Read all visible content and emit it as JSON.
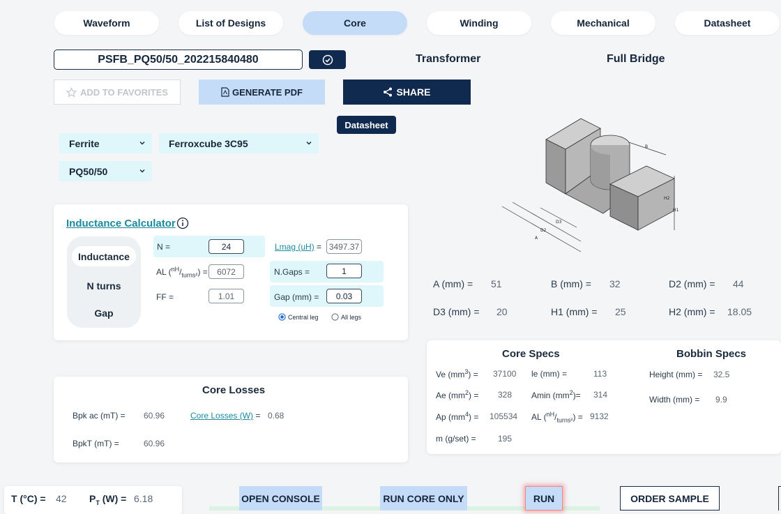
{
  "tabs": [
    {
      "label": "Waveform",
      "active": false
    },
    {
      "label": "List of Designs",
      "active": false
    },
    {
      "label": "Core",
      "active": true
    },
    {
      "label": "Winding",
      "active": false
    },
    {
      "label": "Mechanical",
      "active": false
    },
    {
      "label": "Datasheet",
      "active": false
    }
  ],
  "design": {
    "name": "PSFB_PQ50/50_202215840480",
    "type": "Transformer",
    "topology": "Full Bridge"
  },
  "actions": {
    "favorites": "ADD TO FAVORITES",
    "pdf": "GENERATE PDF",
    "share": "SHARE",
    "datasheet": "Datasheet"
  },
  "selects": {
    "material_type": "Ferrite",
    "material": "Ferroxcube 3C95",
    "shape": "PQ50/50"
  },
  "inductance_calc": {
    "title": "Inductance Calculator",
    "modes": [
      "Inductance",
      "N turns",
      "Gap"
    ],
    "active_mode": "Inductance",
    "n_label": "N =",
    "n_value": "24",
    "al_label_pre": "AL (",
    "al_label_sup": "nH",
    "al_label_sub": "turns²",
    "al_label_post": ") =",
    "al_value": "6072",
    "ff_label": "FF =",
    "ff_value": "1.01",
    "lmag_label": "Lmag (uH)",
    "lmag_eq": "=",
    "lmag_value": "3497.37",
    "ngaps_label": "N.Gaps =",
    "ngaps_value": "1",
    "gap_label": "Gap (mm) =",
    "gap_value": "0.03",
    "radio_central": "Central leg",
    "radio_all": "All legs"
  },
  "dimensions": {
    "a_label": "A (mm) =",
    "a_value": "51",
    "b_label": "B (mm) =",
    "b_value": "32",
    "d2_label": "D2 (mm) =",
    "d2_value": "44",
    "d3_label": "D3 (mm) =",
    "d3_value": "20",
    "h1_label": "H1 (mm) =",
    "h1_value": "25",
    "h2_label": "H2 (mm) =",
    "h2_value": "18.05"
  },
  "drawing_labels": {
    "a": "A",
    "b": "B",
    "d2": "D2",
    "d3": "D3",
    "h1": "H1",
    "h2": "H2"
  },
  "core_specs": {
    "title": "Core Specs",
    "ve_label": "Ve (mm",
    "ve_sup": "3",
    "ve_post": ") =",
    "ve_value": "37100",
    "le_label": "le (mm) =",
    "le_value": "113",
    "ae_label": "Ae (mm",
    "ae_sup": "2",
    "ae_post": ") =",
    "ae_value": "328",
    "amin_label": "Amin (mm",
    "amin_sup": "2",
    "amin_post": ")=",
    "amin_value": "314",
    "ap_label": "Ap (mm",
    "ap_sup": "4",
    "ap_post": ") =",
    "ap_value": "105534",
    "al_label_pre": "AL (",
    "al_sup": "nH",
    "al_sub": "turns²",
    "al_post": ") =",
    "al_value": "9132",
    "m_label": "m (g/set) =",
    "m_value": "195"
  },
  "bobbin_specs": {
    "title": "Bobbin Specs",
    "height_label": "Height (mm) =",
    "height_value": "32.5",
    "width_label": "Width (mm) =",
    "width_value": "9.9"
  },
  "core_losses": {
    "title": "Core Losses",
    "bpk_label": "Bpk ac (mT) =",
    "bpk_value": "60.96",
    "losses_label": "Core Losses (W)",
    "losses_eq": "=",
    "losses_value": "0.68",
    "bpkt_label": "BpkT (mT) =",
    "bpkt_value": "60.96"
  },
  "bottom": {
    "t_label": "T (°C) =",
    "t_value": "42",
    "p_label_main": "P",
    "p_label_sub": "T",
    "p_label_post": " (W) =",
    "p_value": "6.18",
    "open_console": "OPEN CONSOLE",
    "run_core_only": "RUN CORE ONLY",
    "run": "RUN",
    "order_sample": "ORDER SAMPLE"
  },
  "colors": {
    "navy": "#102a4f",
    "light_blue": "#c4dcf8",
    "cyan": "#dff7fa",
    "teal_link": "#1b8a9a"
  }
}
